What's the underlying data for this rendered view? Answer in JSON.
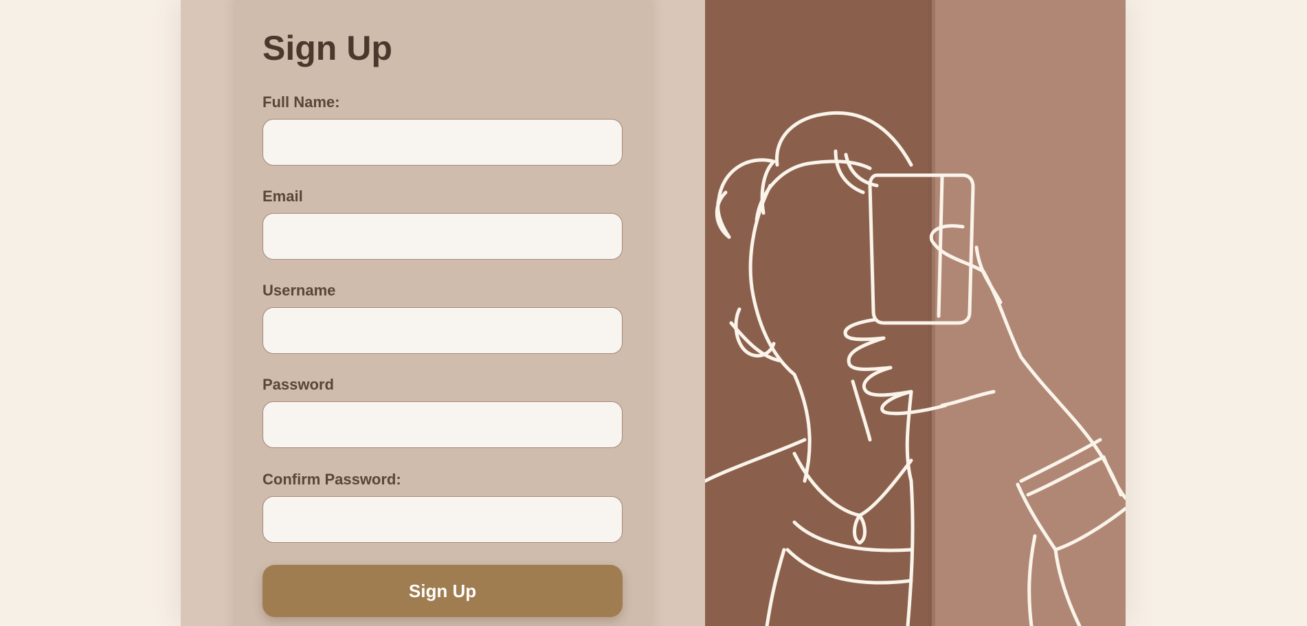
{
  "form": {
    "title": "Sign Up",
    "fields": [
      {
        "label": "Full Name:",
        "value": "",
        "placeholder": ""
      },
      {
        "label": "Email",
        "value": "",
        "placeholder": ""
      },
      {
        "label": "Username",
        "value": "",
        "placeholder": ""
      },
      {
        "label": "Password",
        "value": "",
        "placeholder": ""
      },
      {
        "label": "Confirm Password:",
        "value": "",
        "placeholder": ""
      }
    ],
    "submit_label": "Sign Up"
  },
  "illustration": {
    "icon": "selfie-line-drawing",
    "colors": {
      "panel_dark": "#8a604d",
      "panel_light": "#b08775",
      "line": "#fbf4ea"
    }
  },
  "colors": {
    "page_background": "#f7f0e7",
    "container": "#dac6b8",
    "card": "#cfbcad",
    "button": "#a07c51",
    "input_background": "#f8f4f0",
    "text_dark": "#4a382c"
  }
}
